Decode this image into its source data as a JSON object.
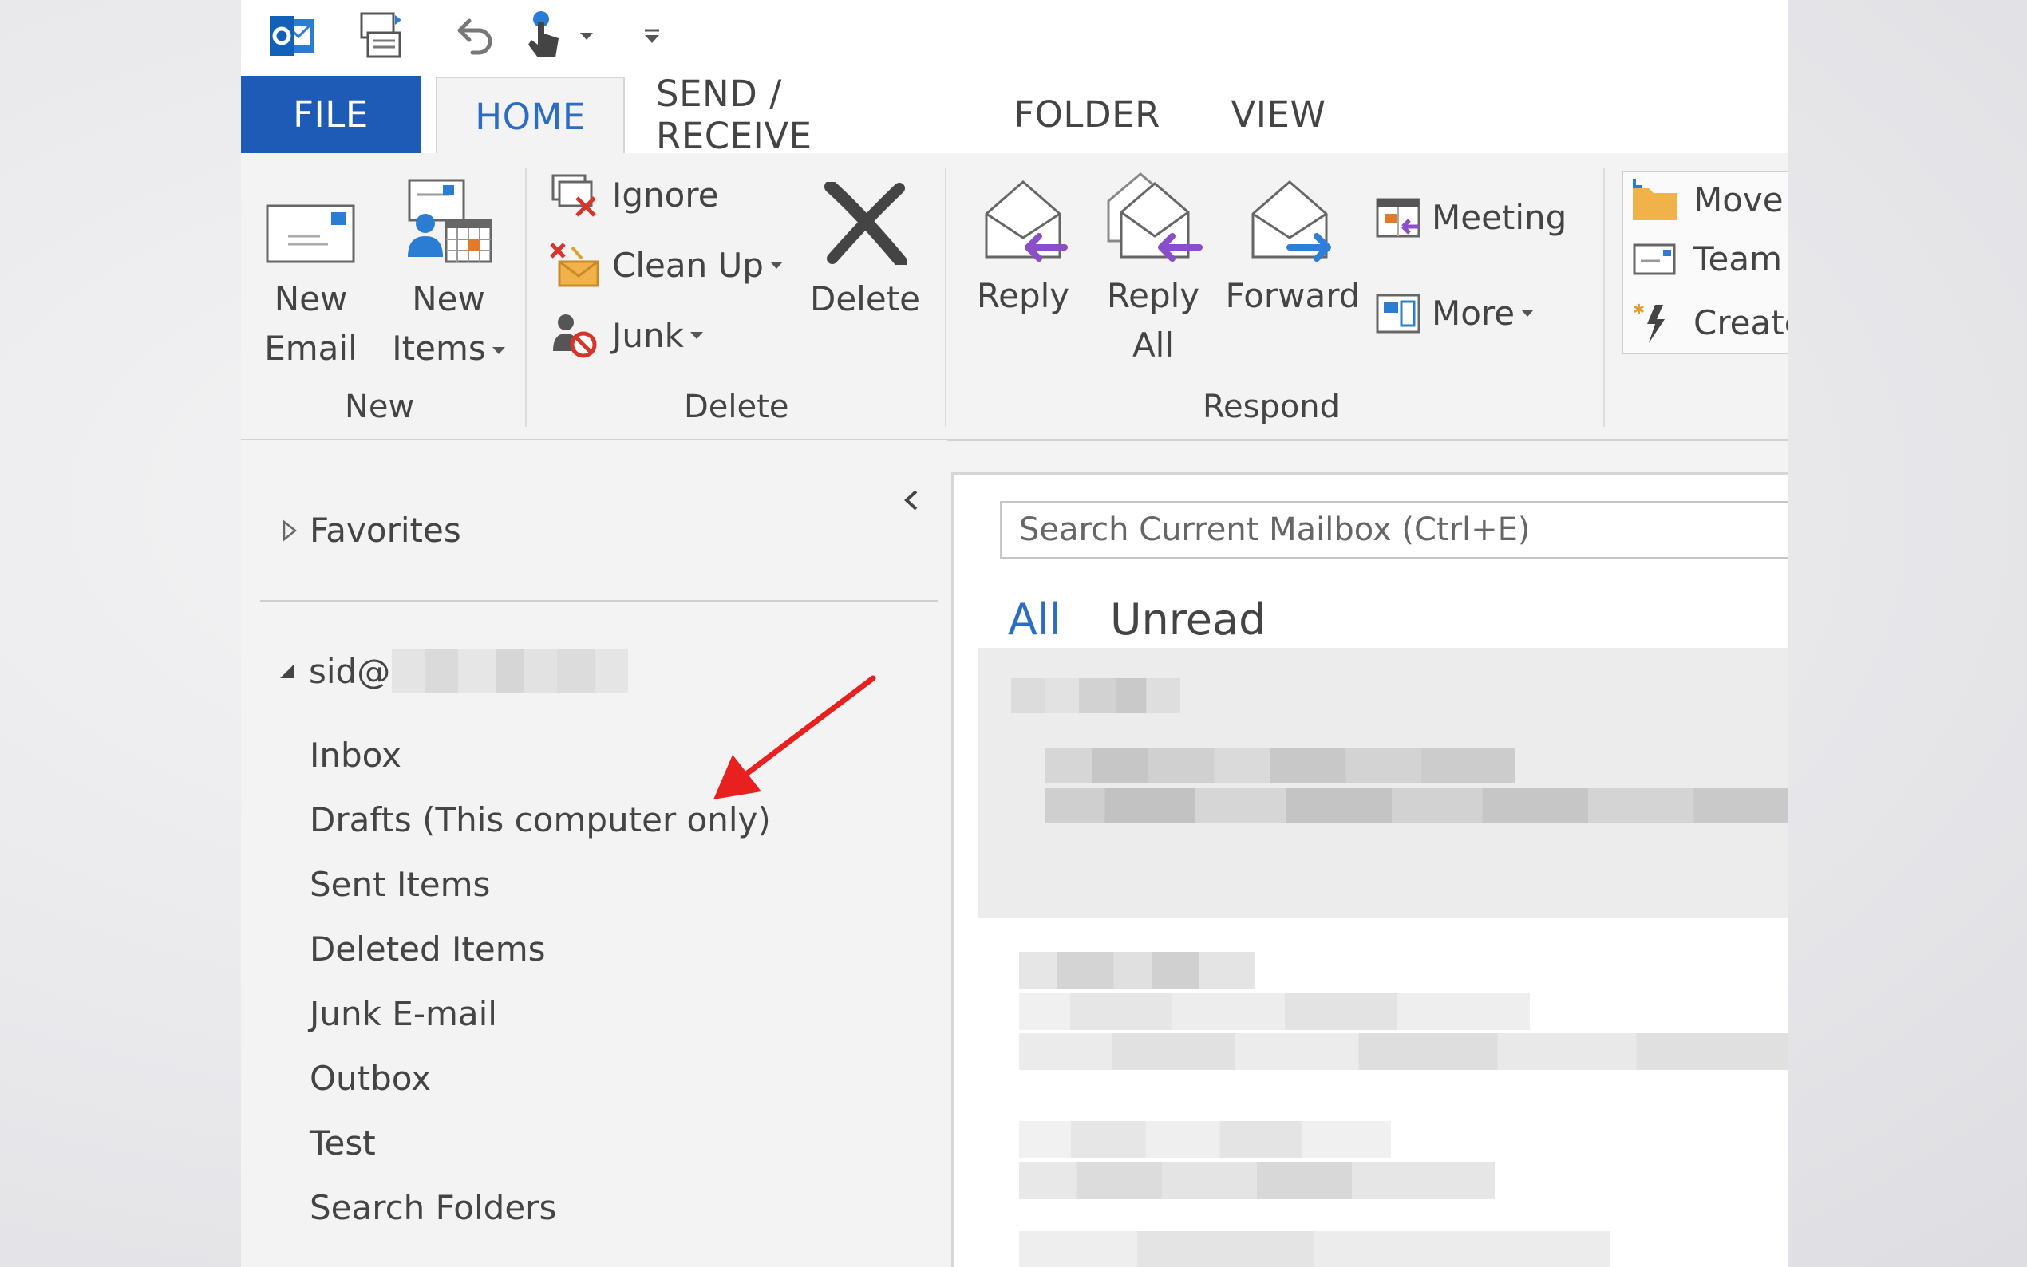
{
  "ribbon_tabs": {
    "file": "FILE",
    "home": "HOME",
    "send_receive": "SEND / RECEIVE",
    "folder": "FOLDER",
    "view": "VIEW"
  },
  "ribbon": {
    "new_group": {
      "label": "New",
      "new_email_line1": "New",
      "new_email_line2": "Email",
      "new_items_line1": "New",
      "new_items_line2": "Items"
    },
    "delete_group": {
      "label": "Delete",
      "ignore": "Ignore",
      "clean_up": "Clean Up",
      "junk": "Junk",
      "delete": "Delete"
    },
    "respond_group": {
      "label": "Respond",
      "reply": "Reply",
      "reply_all_line1": "Reply",
      "reply_all_line2": "All",
      "forward": "Forward",
      "meeting": "Meeting",
      "more": "More"
    },
    "quick_steps": {
      "move": "Move",
      "team": "Team",
      "create": "Create"
    }
  },
  "folder_pane": {
    "favorites": "Favorites",
    "account": "sid@",
    "folders": [
      "Inbox",
      "Drafts (This computer only)",
      "Sent Items",
      "Deleted Items",
      "Junk E-mail",
      "Outbox",
      "Test",
      "Search Folders"
    ]
  },
  "message_list": {
    "search_placeholder": "Search Current Mailbox (Ctrl+E)",
    "filter_all": "All",
    "filter_unread": "Unread"
  },
  "colors": {
    "file_tab": "#1e5bb7",
    "active_tab_text": "#2b6cc4",
    "annotation_arrow": "#e82020",
    "respond_arrow": "#8a4fc8",
    "forward_arrow": "#2f7fd6"
  }
}
